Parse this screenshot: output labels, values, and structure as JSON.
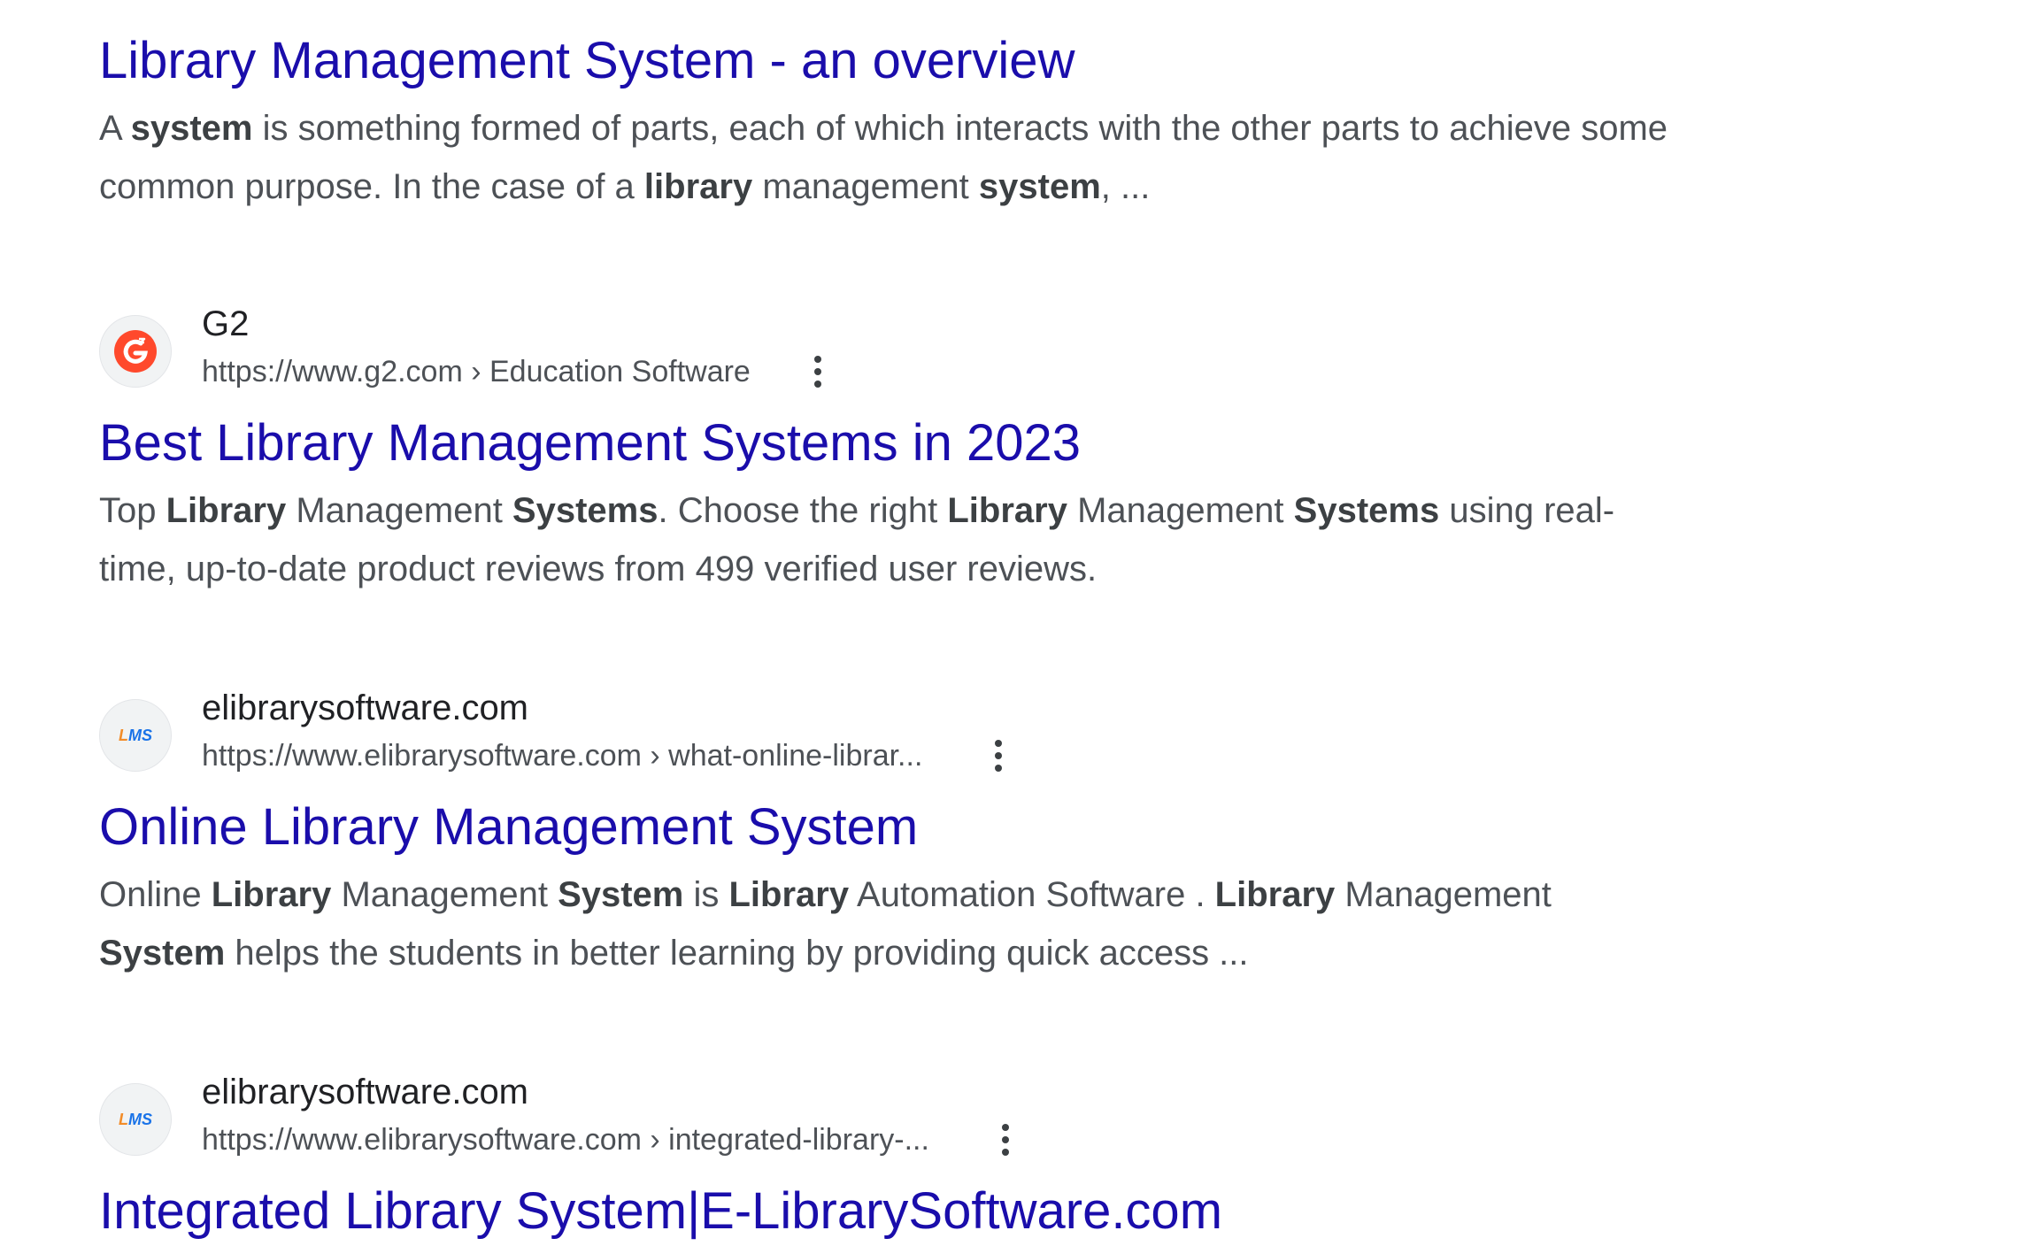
{
  "results": [
    {
      "id": "overview",
      "title": "Library Management System - an overview",
      "snippet_parts": [
        {
          "t": "A ",
          "b": false
        },
        {
          "t": "system",
          "b": true
        },
        {
          "t": " is something formed of parts, each of which interacts with the other parts to achieve some common purpose. In the case of a ",
          "b": false
        },
        {
          "t": "library",
          "b": true
        },
        {
          "t": " management ",
          "b": false
        },
        {
          "t": "system",
          "b": true
        },
        {
          "t": ", ...",
          "b": false
        }
      ]
    },
    {
      "id": "g2",
      "favicon": "g2-logo-icon",
      "site_name": "G2",
      "url_base": "https://www.g2.com",
      "url_path": " › Education Software",
      "title": "Best Library Management Systems in 2023",
      "snippet_parts": [
        {
          "t": "Top ",
          "b": false
        },
        {
          "t": "Library",
          "b": true
        },
        {
          "t": " Management ",
          "b": false
        },
        {
          "t": "Systems",
          "b": true
        },
        {
          "t": ". Choose the right ",
          "b": false
        },
        {
          "t": "Library",
          "b": true
        },
        {
          "t": " Management ",
          "b": false
        },
        {
          "t": "Systems",
          "b": true
        },
        {
          "t": " using real-time, up-to-date product reviews from 499 verified user reviews.",
          "b": false
        }
      ]
    },
    {
      "id": "elibrary-online",
      "favicon": "lms-logo-icon",
      "favicon_text": "LMS",
      "site_name": "elibrarysoftware.com",
      "url_base": "https://www.elibrarysoftware.com",
      "url_path": " › what-online-librar...",
      "title": "Online Library Management System",
      "snippet_parts": [
        {
          "t": "Online ",
          "b": false
        },
        {
          "t": "Library",
          "b": true
        },
        {
          "t": " Management ",
          "b": false
        },
        {
          "t": "System",
          "b": true
        },
        {
          "t": " is ",
          "b": false
        },
        {
          "t": "Library",
          "b": true
        },
        {
          "t": " Automation Software . ",
          "b": false
        },
        {
          "t": "Library",
          "b": true
        },
        {
          "t": " Management ",
          "b": false
        },
        {
          "t": "System",
          "b": true
        },
        {
          "t": " helps the students in better learning by providing quick access ...",
          "b": false
        }
      ]
    },
    {
      "id": "elibrary-integrated",
      "favicon": "lms-logo-icon",
      "favicon_text": "LMS",
      "site_name": "elibrarysoftware.com",
      "url_base": "https://www.elibrarysoftware.com",
      "url_path": " › integrated-library-...",
      "title": "Integrated Library System|E-LibrarySoftware.com"
    }
  ],
  "colors": {
    "link": "#1a0dab",
    "snippet_text": "#4d5156",
    "bold_text": "#3c4043",
    "g2_red": "#ff492c",
    "lms_orange": "#f28c28",
    "lms_blue": "#1a73e8"
  }
}
